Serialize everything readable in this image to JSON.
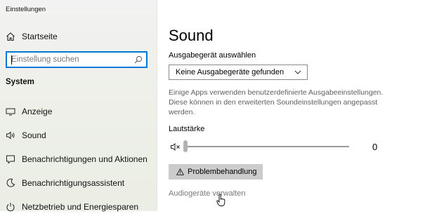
{
  "app": {
    "title": "Einstellungen"
  },
  "sidebar": {
    "home_label": "Startseite",
    "search": {
      "placeholder": "Einstellung suchen",
      "value": ""
    },
    "section_label": "System",
    "items": [
      {
        "label": "Anzeige",
        "icon": "monitor-icon"
      },
      {
        "label": "Sound",
        "icon": "speaker-icon"
      },
      {
        "label": "Benachrichtigungen und Aktionen",
        "icon": "notifications-icon"
      },
      {
        "label": "Benachrichtigungsassistent",
        "icon": "focus-assist-icon"
      },
      {
        "label": "Netzbetrieb und Energiesparen",
        "icon": "power-icon"
      }
    ]
  },
  "main": {
    "title": "Sound",
    "output_label": "Ausgabegerät auswählen",
    "output_selected": "Keine Ausgabegeräte gefunden",
    "description": "Einige Apps verwenden benutzerdefinierte Ausgabeeinstellungen. Diese können in den erweiterten Soundeinstellungen angepasst werden.",
    "volume_label": "Lautstärke",
    "volume_value": "0",
    "volume_level": 0,
    "troubleshoot_label": "Problembehandlung",
    "manage_devices_label": "Audiogeräte verwalten"
  },
  "colors": {
    "accent": "#0078d7",
    "button_bg": "#cccccc",
    "disabled_text": "#7a7a7a"
  }
}
